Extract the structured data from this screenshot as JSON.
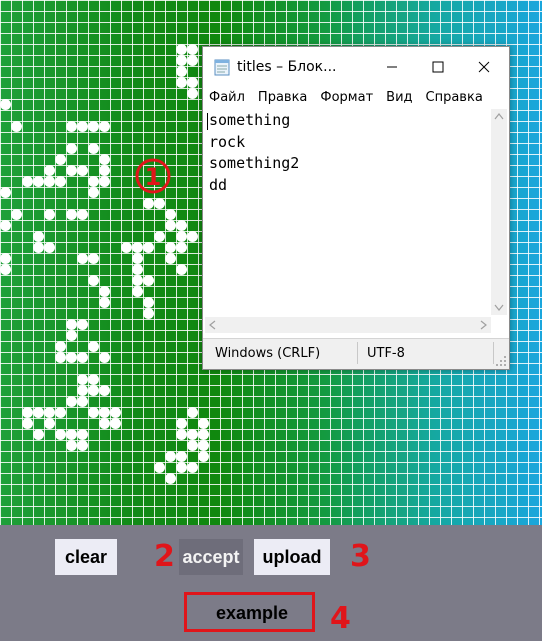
{
  "background": {
    "grid_color": "#ffffff",
    "gradient_colors": [
      "#1fa03a",
      "#128a18",
      "#149a40",
      "#15a8a0",
      "#1aa6dd"
    ],
    "marker_label": "1",
    "marker_color": "#e0151a"
  },
  "notepad": {
    "title": "titles – Блок...",
    "icon": "notepad-icon",
    "menu": [
      "Файл",
      "Правка",
      "Формат",
      "Вид",
      "Справка"
    ],
    "lines": [
      "something",
      "rock",
      "something2",
      "dd"
    ],
    "status": {
      "line_ending": "Windows (CRLF)",
      "encoding": "UTF-8"
    }
  },
  "panel": {
    "background": "#7c7b88",
    "buttons": {
      "clear": "clear",
      "accept": "accept",
      "upload": "upload",
      "example": "example"
    },
    "annotations": {
      "accept": "2",
      "upload": "3",
      "example": "4"
    }
  }
}
